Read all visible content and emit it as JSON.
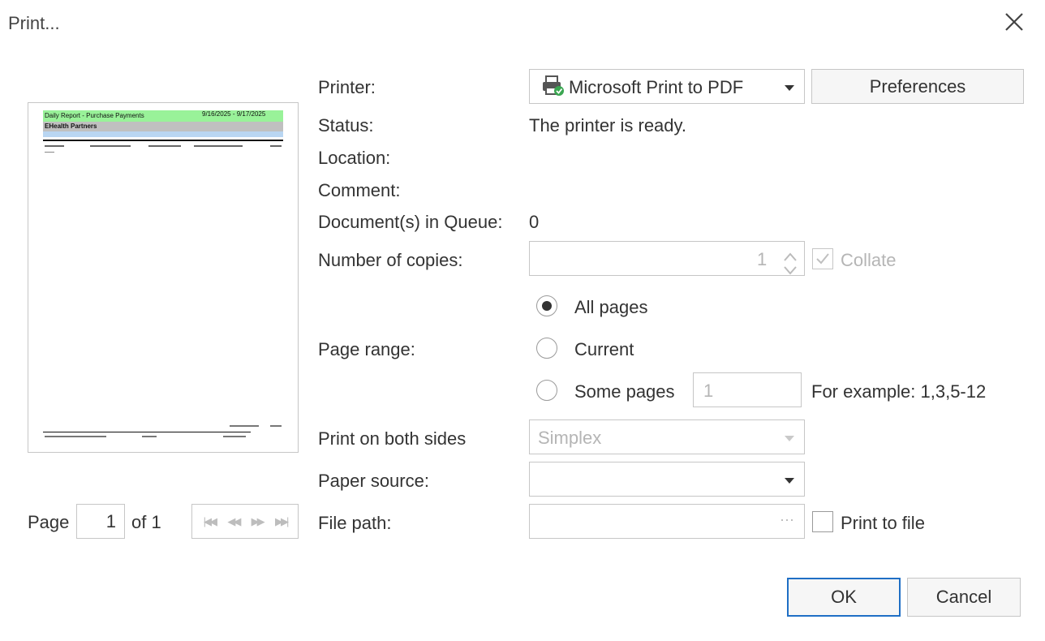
{
  "dialog": {
    "title": "Print..."
  },
  "preview": {
    "report_title": "Daily Report - Purchase Payments",
    "date_range": "9/16/2025 - 9/17/2025",
    "subtitle": "EHealth Partners"
  },
  "page_nav": {
    "page_label": "Page",
    "page_value": "1",
    "of_label": "of 1"
  },
  "fields": {
    "printer_label": "Printer:",
    "printer_value": "Microsoft Print to PDF",
    "preferences_label": "Preferences",
    "status_label": "Status:",
    "status_value": "The printer is ready.",
    "location_label": "Location:",
    "comment_label": "Comment:",
    "queue_label": "Document(s) in Queue:",
    "queue_value": "0",
    "copies_label": "Number of copies:",
    "copies_value": "1",
    "collate_label": "Collate",
    "page_range_label": "Page range:",
    "all_pages_label": "All pages",
    "current_label": "Current",
    "some_pages_label": "Some pages",
    "some_pages_value": "1",
    "example_hint": "For example: 1,3,5-12",
    "both_sides_label": "Print on both sides",
    "both_sides_value": "Simplex",
    "paper_source_label": "Paper source:",
    "paper_source_value": "",
    "file_path_label": "File path:",
    "file_path_browse": "···",
    "print_to_file_label": "Print to file"
  },
  "buttons": {
    "ok_label": "OK",
    "cancel_label": "Cancel"
  },
  "colors": {
    "accent": "#1f6fc5",
    "border": "#c6c6c6",
    "disabled_text": "#b5b5b5",
    "preview_green": "#99f299",
    "preview_gray": "#c0c0c0"
  },
  "icons": {
    "close": "close-icon",
    "printer": "printer-icon"
  }
}
